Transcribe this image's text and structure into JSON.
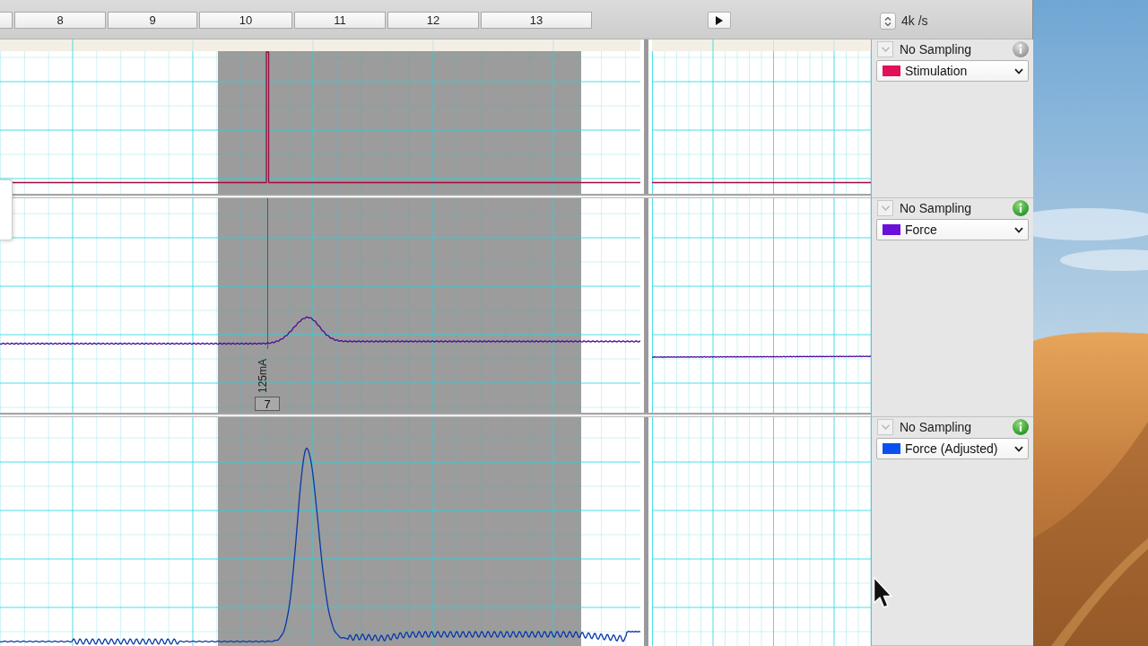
{
  "timeline": {
    "ticks": [
      "8",
      "9",
      "10",
      "11",
      "12",
      "13"
    ]
  },
  "toolbar": {
    "sample_rate": "4k /s"
  },
  "channels": [
    {
      "name": "Stimulation",
      "color": "#e0105a",
      "sampling": "No Sampling",
      "info_active": false,
      "kind": "pulse"
    },
    {
      "name": "Force",
      "color": "#6a10d8",
      "sampling": "No Sampling",
      "info_active": true,
      "kind": "twitch",
      "marker": {
        "label": "125mA",
        "number": "7"
      }
    },
    {
      "name": "Force (Adjusted)",
      "color": "#0a50f0",
      "sampling": "No Sampling",
      "info_active": true,
      "kind": "oscillating"
    }
  ]
}
